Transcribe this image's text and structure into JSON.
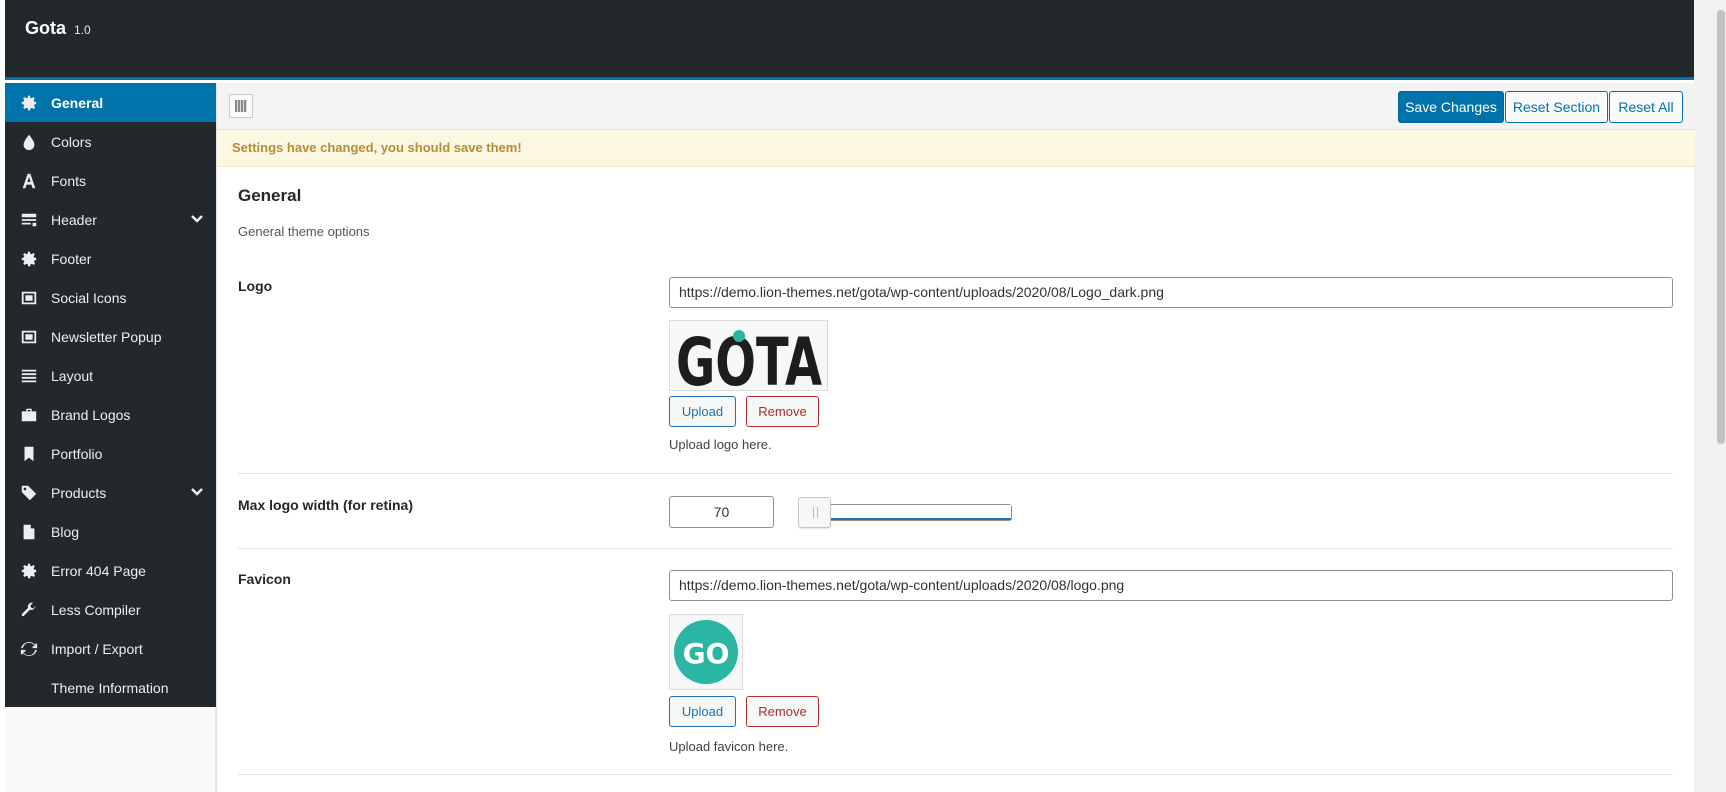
{
  "app": {
    "name": "Gota",
    "version": "1.0"
  },
  "sidebar": {
    "items": [
      {
        "label": "General",
        "icon": "gear-icon",
        "active": true
      },
      {
        "label": "Colors",
        "icon": "drop-icon"
      },
      {
        "label": "Fonts",
        "icon": "font-icon"
      },
      {
        "label": "Header",
        "icon": "header-icon",
        "has_submenu": true
      },
      {
        "label": "Footer",
        "icon": "gear-icon"
      },
      {
        "label": "Social Icons",
        "icon": "screen-icon"
      },
      {
        "label": "Newsletter Popup",
        "icon": "screen-icon"
      },
      {
        "label": "Layout",
        "icon": "list-icon"
      },
      {
        "label": "Brand Logos",
        "icon": "briefcase-icon"
      },
      {
        "label": "Portfolio",
        "icon": "bookmark-icon"
      },
      {
        "label": "Products",
        "icon": "tags-icon",
        "has_submenu": true
      },
      {
        "label": "Blog",
        "icon": "document-icon"
      },
      {
        "label": "Error 404 Page",
        "icon": "gear-icon"
      },
      {
        "label": "Less Compiler",
        "icon": "wrench-icon"
      },
      {
        "label": "Import / Export",
        "icon": "refresh-icon"
      },
      {
        "label": "Theme Information",
        "icon": ""
      }
    ]
  },
  "toolbar": {
    "save_label": "Save Changes",
    "reset_section_label": "Reset Section",
    "reset_all_label": "Reset All"
  },
  "notice": "Settings have changed, you should save them!",
  "section": {
    "title": "General",
    "description": "General theme options"
  },
  "fields": {
    "logo": {
      "label": "Logo",
      "value": "https://demo.lion-themes.net/gota/wp-content/uploads/2020/08/Logo_dark.png",
      "preview_text": "GOTA",
      "upload_label": "Upload",
      "remove_label": "Remove",
      "help": "Upload logo here."
    },
    "max_logo_width": {
      "label": "Max logo width (for retina)",
      "value": "70"
    },
    "favicon": {
      "label": "Favicon",
      "value": "https://demo.lion-themes.net/gota/wp-content/uploads/2020/08/logo.png",
      "preview_text": "GO",
      "upload_label": "Upload",
      "remove_label": "Remove",
      "help": "Upload favicon here."
    }
  },
  "colors": {
    "accent": "#0073aa",
    "topbar": "#23282d",
    "favicon_teal": "#2bb5a3"
  }
}
